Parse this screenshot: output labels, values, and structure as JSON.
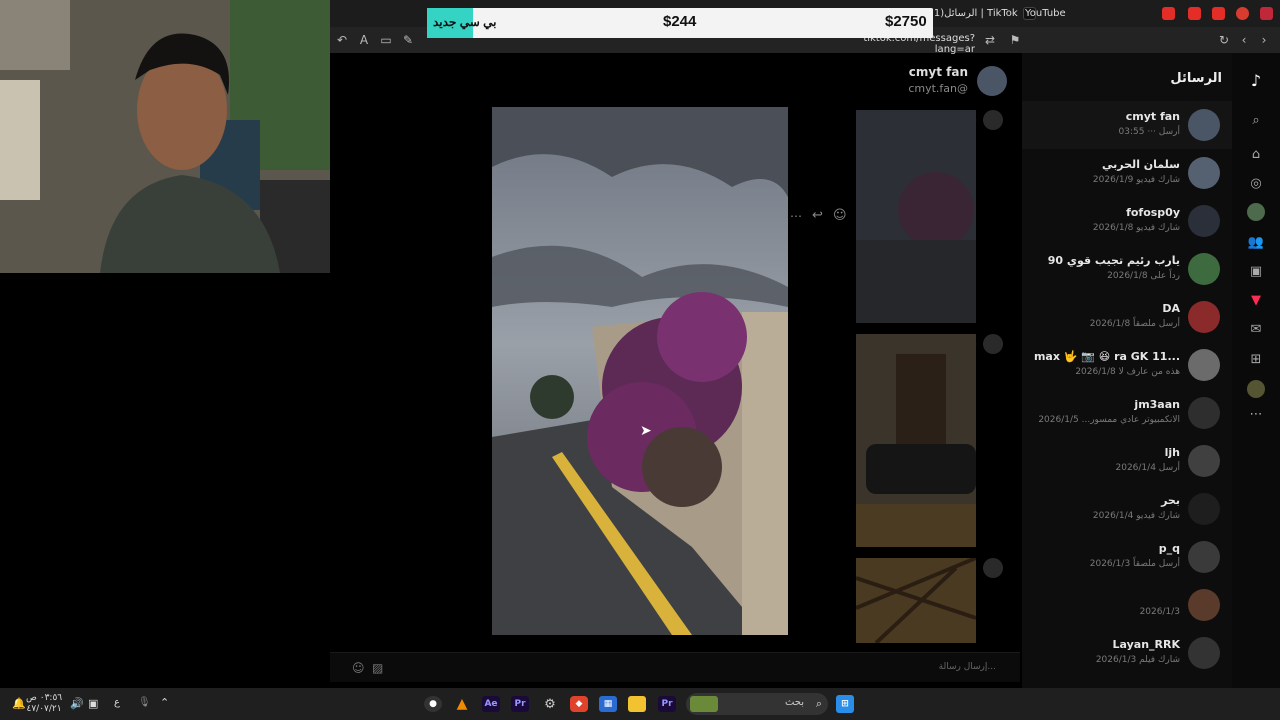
{
  "browser": {
    "tabs": [
      {
        "label": "(1)الرسائل | TikTok"
      },
      {
        "label": "YouTube"
      }
    ],
    "url": "tiktok.com/messages?lang=ar"
  },
  "banner": {
    "subtitle": "بي سي جديد",
    "price_left": "$244",
    "price_right": "$2750"
  },
  "sidebar": {
    "title": "الرسائل",
    "conversations": [
      {
        "name": "cmyt fan",
        "sub": "أرسل ··· 03:55",
        "active": true,
        "color": "#4a5566"
      },
      {
        "name": "سلمان الحربي",
        "sub": "شارك فيديو 2026/1/9",
        "active": false,
        "color": "#556070"
      },
      {
        "name": "fofosp0y",
        "sub": "شارك فيديو 2026/1/8",
        "active": false,
        "color": "#2b2f3a"
      },
      {
        "name": "يارب رئيم تجيب قوي 90",
        "sub": "رداً على 2026/1/8",
        "active": false,
        "color": "#3d6b3f"
      },
      {
        "name": "DA",
        "sub": "أرسل ملصقاً 2026/1/8",
        "active": false,
        "color": "#8a2a2a"
      },
      {
        "name": "max 🤟 📷 😆 ra GK 11...",
        "sub": "2026/1/8 هذه من عارف لا",
        "active": false,
        "color": "#6b6b6b"
      },
      {
        "name": "jm3aan",
        "sub": "الانكمبيوتر عادي ممسور... 2026/1/5",
        "active": false,
        "color": "#2e2e2e"
      },
      {
        "name": "ljh",
        "sub": "أرسل 2026/1/4",
        "active": false,
        "color": "#404040"
      },
      {
        "name": "بحر",
        "sub": "شارك فيديو 2026/1/4",
        "active": false,
        "color": "#1e1e1e"
      },
      {
        "name": "p_q",
        "sub": "أرسل ملصقاً 2026/1/3",
        "active": false,
        "color": "#3a3a3a"
      },
      {
        "name": "",
        "sub": "2026/1/3",
        "active": false,
        "color": "#5a3a2a"
      },
      {
        "name": "Layan_RRK",
        "sub": "شارك فيلم 2026/1/3",
        "active": false,
        "color": "#333"
      }
    ]
  },
  "chat": {
    "name": "cmyt fan",
    "handle": "cmyt.fan@",
    "composer_placeholder": "إرسال رسالة..."
  },
  "taskbar": {
    "search_label": "بحث",
    "time": "٠٣:٥٦ ص",
    "date": "٤٧/٠٧/٢١",
    "lang": "ع"
  },
  "colors": {
    "accent_teal": "#34d3c4",
    "tiktok_red": "#fe2c55"
  }
}
